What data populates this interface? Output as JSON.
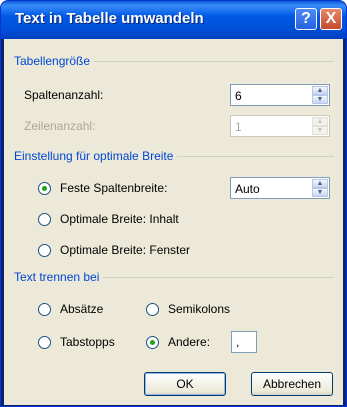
{
  "window": {
    "title": "Text in Tabelle umwandeln",
    "help_label": "?",
    "close_label": "X"
  },
  "size_group": {
    "title": "Tabellengröße",
    "columns_label": "Spaltenanzahl:",
    "columns_value": "6",
    "rows_label": "Zeilenanzahl:",
    "rows_value": "1"
  },
  "width_group": {
    "title": "Einstellung für optimale Breite",
    "fixed_width_label": "Feste Spaltenbreite:",
    "fixed_width_value": "Auto",
    "optimal_content_label": "Optimale Breite: Inhalt",
    "optimal_window_label": "Optimale Breite: Fenster",
    "selected": "fixed"
  },
  "separator_group": {
    "title": "Text trennen bei",
    "paragraphs_label": "Absätze",
    "semicolons_label": "Semikolons",
    "tabs_label": "Tabstopps",
    "other_label": "Andere:",
    "other_value": ",",
    "selected": "other"
  },
  "buttons": {
    "ok_label": "OK",
    "cancel_label": "Abbrechen"
  }
}
